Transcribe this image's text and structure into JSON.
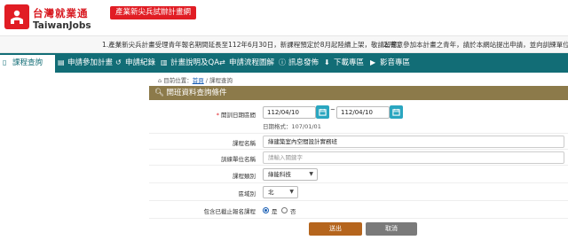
{
  "header": {
    "logo_zh": "台灣就業通",
    "logo_en": "TaiwanJobs",
    "site_tag": "產業新尖兵試辦計畫網"
  },
  "marquee": {
    "items": [
      "1.產業新尖兵計畫受理青年報名期間延長至112年6月30日，新課程預定於8月起陸續上架，敬請留意。",
      "2.有意參加本計畫之青年，請於本網站提出申請，並向訓練單位完成"
    ]
  },
  "nav": {
    "items": [
      {
        "label": "課程查詢",
        "icon": "page-icon",
        "glyph": "▯"
      },
      {
        "label": "申請參加計畫",
        "icon": "id-card-icon",
        "glyph": "▤"
      },
      {
        "label": "申請紀錄",
        "icon": "history-icon",
        "glyph": "↺"
      },
      {
        "label": "計畫說明及QA",
        "icon": "book-icon",
        "glyph": "▥"
      },
      {
        "label": "申請流程圖解",
        "icon": "flow-icon",
        "glyph": "⇄"
      },
      {
        "label": "訊息發佈",
        "icon": "info-icon",
        "glyph": "ⓘ"
      },
      {
        "label": "下載專區",
        "icon": "download-icon",
        "glyph": "⬇"
      },
      {
        "label": "影音專區",
        "icon": "video-icon",
        "glyph": "▶"
      }
    ]
  },
  "breadcrumb": {
    "prefix": "目前位置：",
    "home": "首頁",
    "sep": " / ",
    "current": "課程查詢"
  },
  "panel": {
    "title": "開班資料查詢條件"
  },
  "form": {
    "date_label": "開訓日期區間",
    "date_required": "*",
    "date_from": "112/04/10",
    "date_sep": "~",
    "date_to": "112/04/10",
    "date_hint": "日期格式：107/01/01",
    "course_name_label": "課程名稱",
    "course_name_value": "綠建築室內空間設計實務班",
    "org_label": "訓練單位名稱",
    "org_placeholder": "請輸入關鍵字",
    "category_label": "課程類別",
    "category_value": "綠能科技",
    "region_label": "區域別",
    "region_value": "北",
    "include_label": "包含已截止報名課程",
    "yes_label": "是",
    "no_label": "否"
  },
  "buttons": {
    "submit": "送出",
    "cancel": "取消"
  },
  "colors": {
    "brand_red": "#e11d24",
    "nav_teal": "#126d76",
    "panel_head": "#8c7a4a",
    "calendar_button": "#2aa6c0",
    "submit_button": "#b5651d",
    "cancel_button": "#7a7a7a"
  }
}
